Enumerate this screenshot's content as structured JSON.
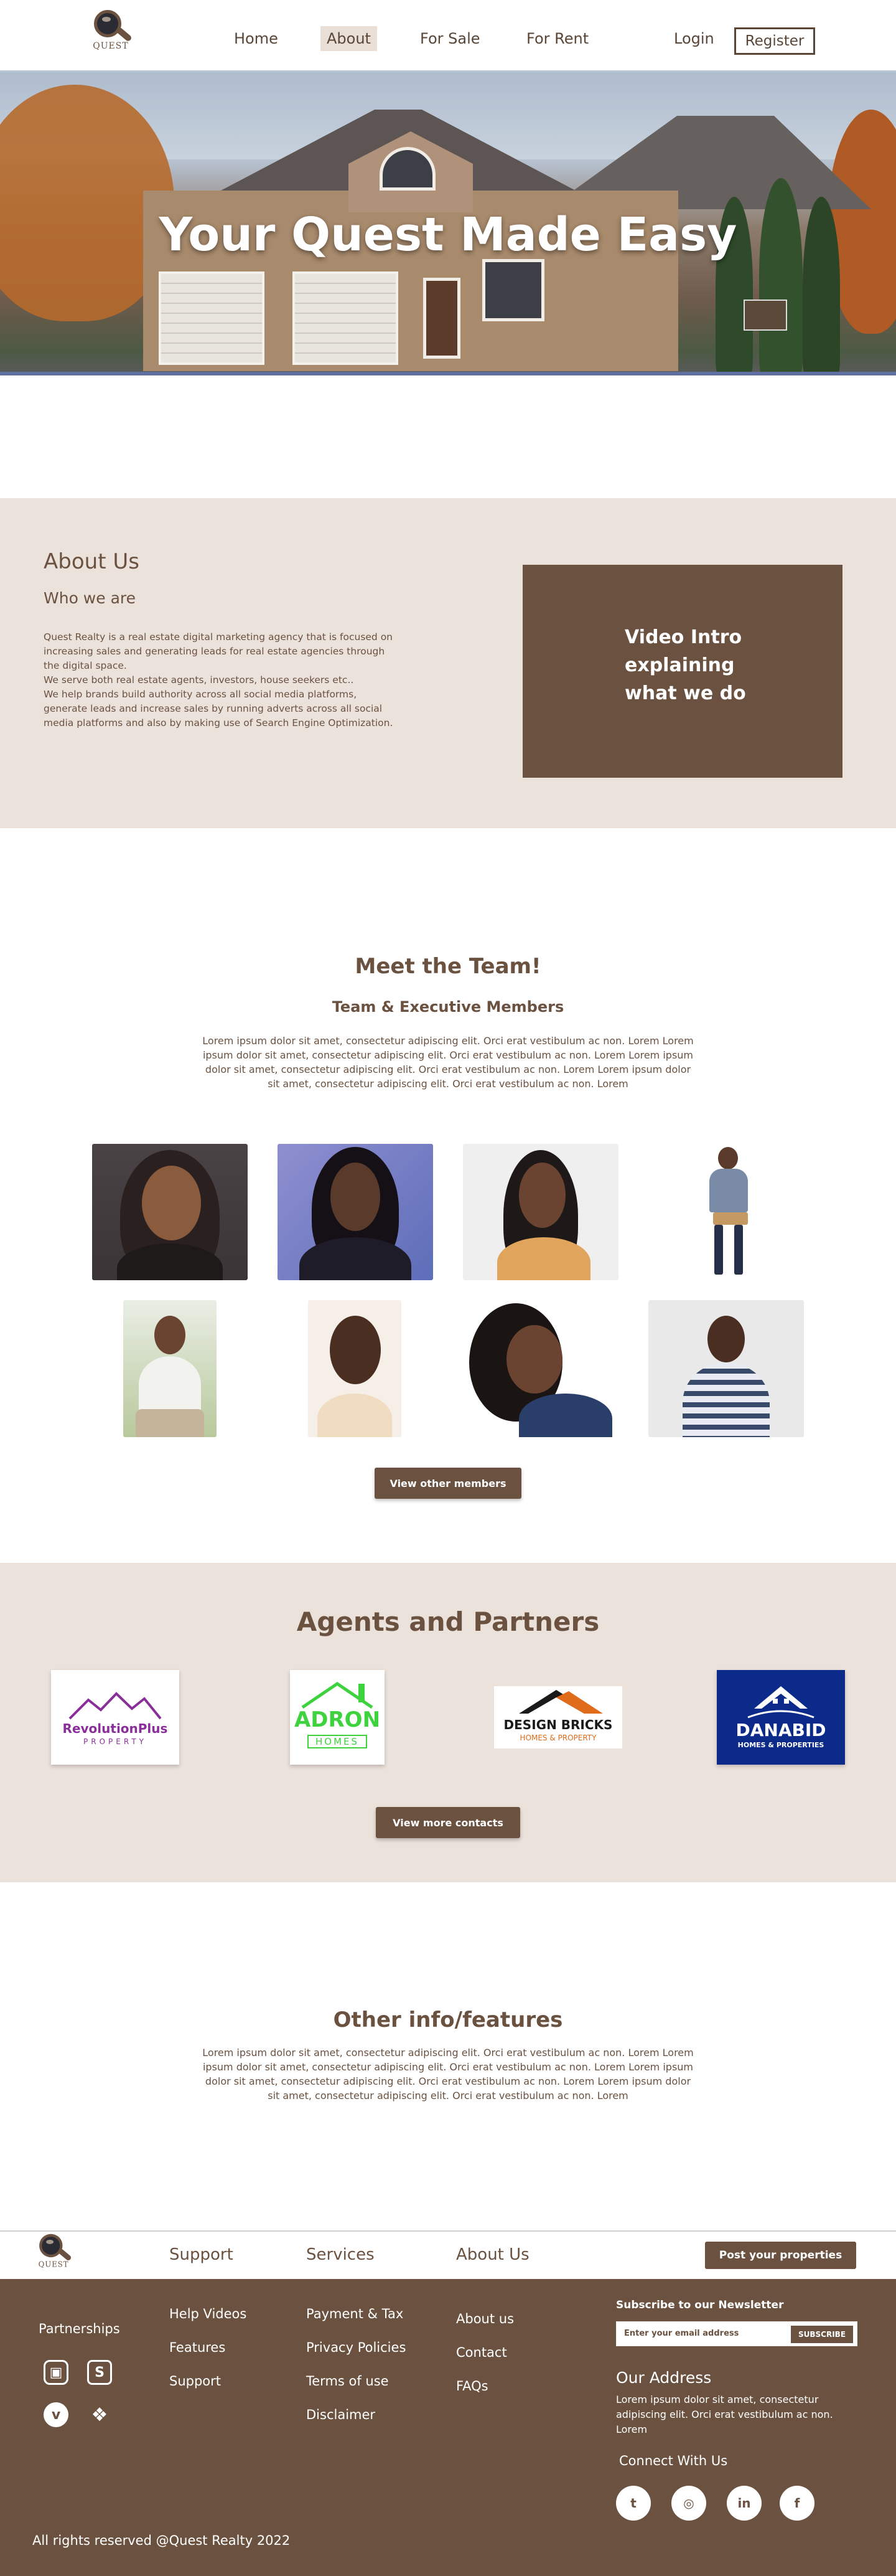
{
  "brand": {
    "logo_text": "QUEST"
  },
  "nav": {
    "items": [
      "Home",
      "About",
      "For Sale",
      "For Rent"
    ],
    "login": "Login",
    "register": "Register"
  },
  "hero": {
    "title": "Your Quest Made Easy"
  },
  "about": {
    "heading": "About Us",
    "subheading": "Who we are",
    "paragraph_1": "Quest Realty is a real estate digital marketing agency that is focused on increasing sales and generating leads for real estate agencies through the digital space.",
    "paragraph_2": "We serve both real estate agents, investors, house seekers etc..",
    "paragraph_3": "We help brands build authority across all social media platforms, generate leads and increase sales by running adverts across all social media platforms and also by making use of Search Engine Optimization.",
    "video_text": "Video Intro explaining what we do"
  },
  "team": {
    "title": "Meet the Team!",
    "subtitle": "Team & Executive Members",
    "lorem": "Lorem ipsum dolor sit amet, consectetur adipiscing elit. Orci erat vestibulum ac non. Lorem Lorem ipsum dolor sit amet, consectetur adipiscing elit. Orci erat vestibulum ac non. Lorem Lorem ipsum dolor sit amet, consectetur adipiscing elit. Orci erat vestibulum ac non. Lorem Lorem ipsum dolor sit amet, consectetur adipiscing elit. Orci erat vestibulum ac non. Lorem",
    "button": "View other members"
  },
  "partners": {
    "title": "Agents and Partners",
    "logos": [
      {
        "name": "RevolutionPlus",
        "tagline": "PROPERTY",
        "color": "#8a2f9a"
      },
      {
        "name": "ADRON",
        "tagline": "HOMES",
        "color": "#3ed33e"
      },
      {
        "name": "DESIGN BRICKS",
        "tagline": "HOMES & PROPERTY",
        "color": "#e06b1a"
      },
      {
        "name": "DANABID",
        "tagline": "HOMES & PROPERTIES",
        "color": "#0b2a8a"
      }
    ],
    "button": "View more contacts"
  },
  "other": {
    "title": "Other info/features",
    "lorem": "Lorem ipsum dolor sit amet, consectetur adipiscing elit. Orci erat vestibulum ac non. Lorem Lorem ipsum dolor sit amet, consectetur adipiscing elit. Orci erat vestibulum ac non. Lorem Lorem ipsum dolor sit amet, consectetur adipiscing elit. Orci erat vestibulum ac non. Lorem Lorem ipsum dolor sit amet, consectetur adipiscing elit. Orci erat vestibulum ac non. Lorem"
  },
  "footer_top": {
    "links": [
      "Support",
      "Services",
      "About Us"
    ],
    "post_button": "Post your properties"
  },
  "footer": {
    "partnerships": "Partnerships",
    "partner_icons": [
      "bitbucket-icon",
      "stackshare-icon",
      "vimeo-icon",
      "dropbox-icon"
    ],
    "col1": [
      "Help Videos",
      "Features",
      "Support"
    ],
    "col2": [
      "Payment & Tax",
      "Privacy Policies",
      "Terms of use",
      "Disclaimer"
    ],
    "col3": [
      "About us",
      "Contact",
      "FAQs"
    ],
    "newsletter_title": "Subscribe to our Newsletter",
    "newsletter_placeholder": "Enter your email address",
    "subscribe": "SUBSCRIBE",
    "address_title": "Our Address",
    "address_text": "Lorem ipsum dolor sit amet, consectetur adipiscing elit. Orci erat vestibulum ac non. Lorem",
    "connect": "Connect With Us",
    "social": [
      "twitter-icon",
      "instagram-icon",
      "linkedin-icon",
      "facebook-icon"
    ],
    "copyright": "All rights reserved @Quest Realty 2022"
  },
  "colors": {
    "brand": "#6b5240",
    "section_bg": "#ece2dc",
    "white": "#ffffff"
  }
}
